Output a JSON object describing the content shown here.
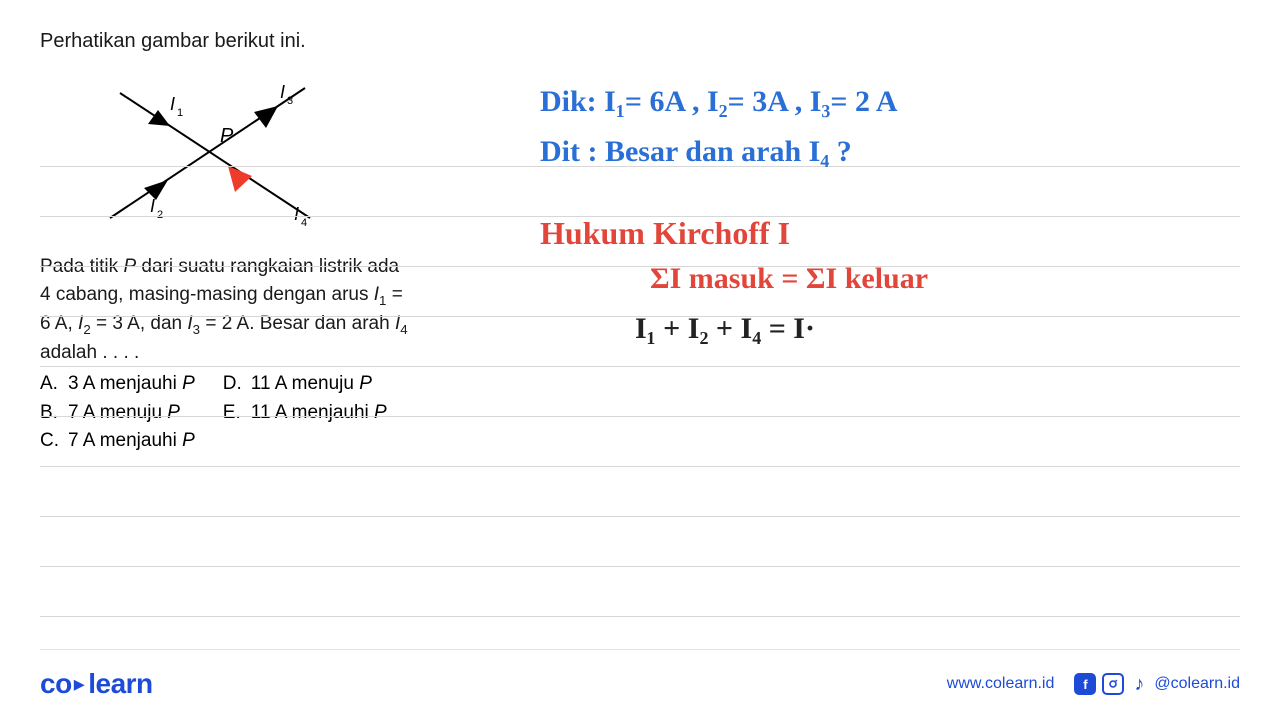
{
  "intro": "Perhatikan gambar berikut ini.",
  "diagram": {
    "point_label": "P",
    "labels": {
      "i1": "I₁",
      "i2": "I₂",
      "i3": "I₃",
      "i4": "I₄"
    }
  },
  "problem": {
    "line1a": "Pada titik ",
    "line1b": "P",
    "line1c": " dari suatu rangkaian listrik ada",
    "line2a": "4 cabang, masing-masing dengan arus ",
    "line2b": "I",
    "line2c": "1",
    "line2d": " =",
    "line3a": "6 A, ",
    "line3b": "I",
    "line3c": "2",
    "line3d": " = 3 A, dan ",
    "line3e": "I",
    "line3f": "3",
    "line3g": " = 2 A. Besar dan arah ",
    "line3h": "I",
    "line3i": "4",
    "line4": "adalah . . . ."
  },
  "options": {
    "A": {
      "label": "A.",
      "text": "3 A menjauhi ",
      "p": "P"
    },
    "B": {
      "label": "B.",
      "text": "7 A menuju ",
      "p": "P"
    },
    "C": {
      "label": "C.",
      "text": "7 A menjauhi ",
      "p": "P"
    },
    "D": {
      "label": "D.",
      "text": "11 A menuju ",
      "p": "P"
    },
    "E": {
      "label": "E.",
      "text": "11 A menjauhi ",
      "p": "P"
    }
  },
  "handwriting": {
    "dik": "Dik: I₁= 6A  , I₂= 3A  , I₃= 2 A",
    "dit": "Dit : Besar  dan  arah  I₄ ?",
    "title": "Hukum  Kirchoff  I",
    "eq1": "ΣI masuk  =  ΣI keluar",
    "eq2": "I₁ + I₂ + I₄  =  I·"
  },
  "footer": {
    "brand_co": "co",
    "brand_learn": "learn",
    "url": "www.colearn.id",
    "handle": "@colearn.id"
  }
}
